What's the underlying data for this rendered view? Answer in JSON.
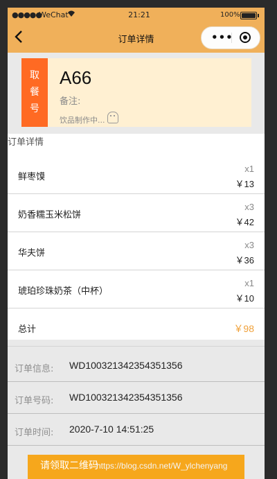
{
  "status_bar": {
    "signal": "●●●●●",
    "carrier": "WeChat",
    "time": "21:21",
    "battery": "100%"
  },
  "nav": {
    "title": "订单详情",
    "back_icon": "chevron-left-icon",
    "more_icon": "more-dots-icon",
    "close_icon": "target-circle-icon"
  },
  "pickup": {
    "tag_chars": [
      "取",
      "餐",
      "号"
    ],
    "code": "A66",
    "note_label": "备注:",
    "status": "饮品制作中..."
  },
  "order": {
    "header": "订单详情",
    "items": [
      {
        "name": "鲜枣馍",
        "qty": "x1",
        "price": "￥13"
      },
      {
        "name": "奶香糯玉米松饼",
        "qty": "x3",
        "price": "￥42"
      },
      {
        "name": "华夫饼",
        "qty": "x3",
        "price": "￥36"
      },
      {
        "name": "琥珀珍珠奶茶（中杯）",
        "qty": "x1",
        "price": "￥10"
      }
    ],
    "total_label": "总计",
    "total_value": "￥98"
  },
  "info": [
    {
      "label": "订单信息:",
      "value": "WD100321342354351356"
    },
    {
      "label": "订单号码:",
      "value": "WD100321342354351356"
    },
    {
      "label": "订单时间:",
      "value": "2020-7-10 14:51:25"
    }
  ],
  "action_button": "请领取二维码",
  "watermark": "https://blog.csdn.net/W_ylchenyang",
  "colors": {
    "accent": "#f0b05a",
    "tag": "#ff6a23",
    "total": "#f0a13a",
    "button": "#f6a71c"
  }
}
